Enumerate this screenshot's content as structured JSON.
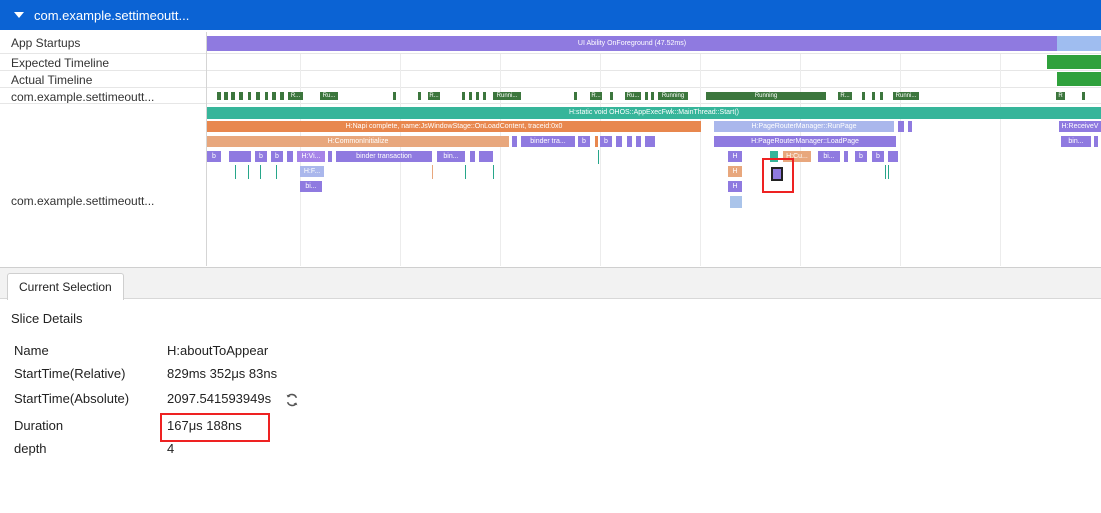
{
  "header": {
    "title": "com.example.settimeoutt..."
  },
  "lanes": {
    "app_startups": "App Startups",
    "expected_timeline": "Expected Timeline",
    "actual_timeline": "Actual Timeline",
    "process_summary": "com.example.settimeoutt...",
    "main_thread": "com.example.settimeoutt..."
  },
  "trace": {
    "startup_slice": "UI Ability OnForeground (47.52ms)",
    "main_thread_start": "H:static void OHOS::AppExecFwk::MainThread::Start()",
    "onload_content": "H:Napi complete, name:JsWindowStage::OnLoadContent, traceid:0x0",
    "run_page": "H:PageRouterManager::RunPage",
    "receive": "H:ReceiveV",
    "common_initialize": "H:CommonInitialize",
    "binder_tra": "binder tra...",
    "load_page": "H:PageRouterManager::LoadPage",
    "bin_short": "bin...",
    "binder_transaction": "binder transaction",
    "b": "b",
    "bi": "bi...",
    "h_vi": "H:Vi...",
    "h_f": "H:F...",
    "h": "H",
    "h_cu": "H:Cu...",
    "running": "Running",
    "runni": "Runni...",
    "ru": "Ru...",
    "r": "R...",
    "r_single": "R",
    "colors": {
      "purple": "#8f7ae0",
      "orange": "#e8874e",
      "teal": "#36b59a",
      "lavender": "#aab7ec",
      "green": "#3c763d",
      "bright_green": "#2fa13c",
      "blue": "#4f86dd"
    }
  },
  "panel": {
    "tab": "Current Selection",
    "section_title": "Slice Details",
    "details": [
      {
        "key": "Name",
        "value": "H:aboutToAppear"
      },
      {
        "key": "StartTime(Relative)",
        "value": "829ms 352μs 83ns"
      },
      {
        "key": "StartTime(Absolute)",
        "value": "2097.541593949s"
      },
      {
        "key": "Duration",
        "value": "167μs 188ns"
      },
      {
        "key": "depth",
        "value": "4"
      }
    ],
    "refresh_icon": "refresh-icon"
  }
}
